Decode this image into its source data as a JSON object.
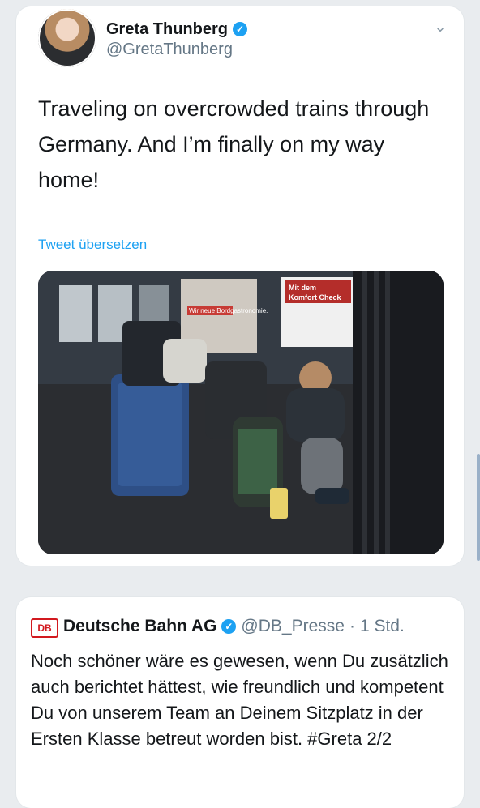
{
  "tweet": {
    "author_name": "Greta Thunberg",
    "author_handle": "@GretaThunberg",
    "text": "Traveling on overcrowded trains through Germany. And I’m finally on my way home!",
    "translate_label": "Tweet übersetzen"
  },
  "reply": {
    "author_logo_text": "DB",
    "author_name": "Deutsche Bahn AG",
    "author_handle": "@DB_Presse",
    "separator": " · ",
    "time": "1 Std.",
    "text": "Noch schöner wäre es gewesen, wenn Du zusätzlich auch berichtet hättest, wie freundlich und kompetent Du von unserem Team an Deinem Sitzplatz in der Ersten Klasse betreut worden bist. #Greta 2/2"
  },
  "icons": {
    "verified": "✓",
    "chevron": "⌄"
  },
  "photo_sign_text": {
    "poster_left": "Wir neue Bordgastronomie.",
    "poster_right_1": "Mit dem",
    "poster_right_2": "Komfort Check"
  },
  "colors": {
    "link": "#1da1f2",
    "db_red": "#d2191f"
  }
}
